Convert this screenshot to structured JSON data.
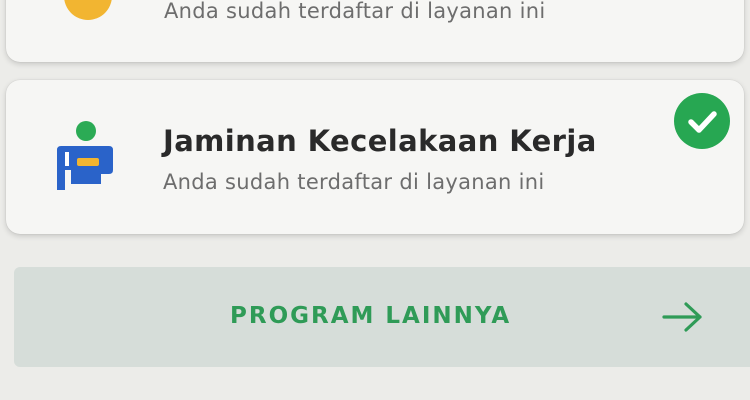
{
  "cards": [
    {
      "subtitle": "Anda sudah terdaftar di layanan ini",
      "icon": "yellow-program-icon"
    },
    {
      "title": "Jaminan Kecelakaan Kerja",
      "subtitle": "Anda sudah terdaftar di layanan ini",
      "icon": "worker-accident-icon",
      "status_icon": "check-circle-icon",
      "status_color": "#27a752"
    }
  ],
  "program_button": {
    "label": "PROGRAM LAINNYA",
    "icon": "arrow-right-icon",
    "color": "#2f9b57"
  }
}
